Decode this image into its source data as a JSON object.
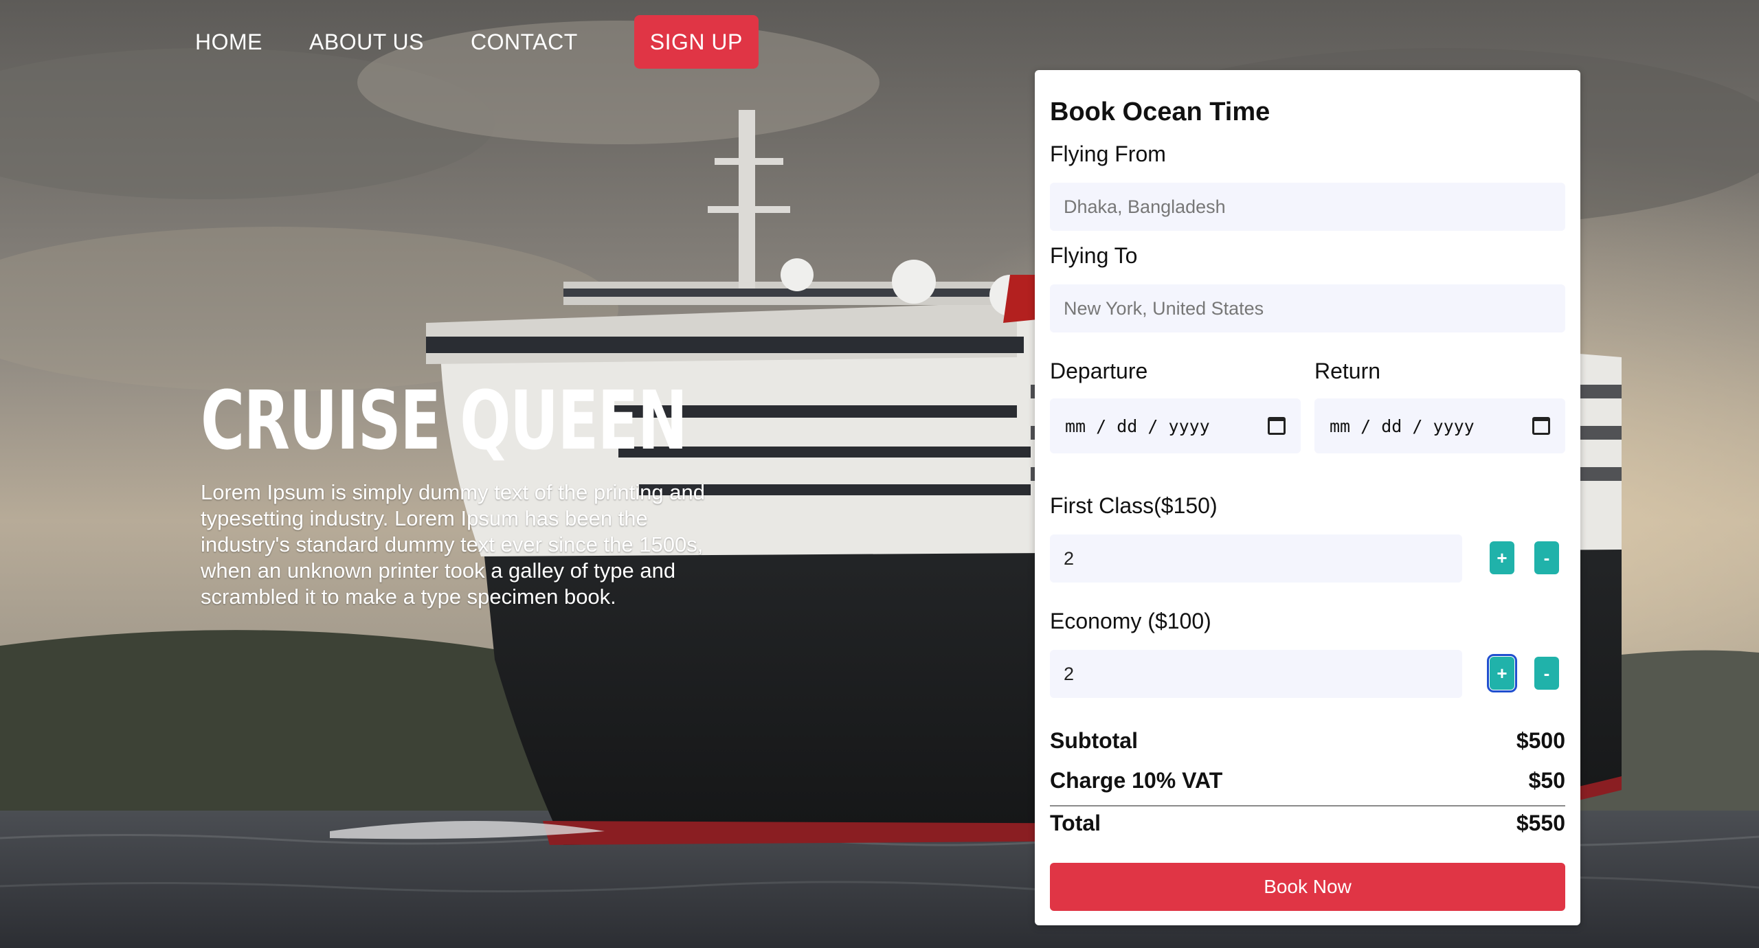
{
  "nav": {
    "items": [
      "HOME",
      "ABOUT US",
      "CONTACT"
    ],
    "signup": "SIGN UP"
  },
  "hero": {
    "title": "CRUISE QUEEN",
    "text": "Lorem Ipsum is simply dummy text of the printing and typesetting industry. Lorem Ipsum has been the industry's standard dummy text ever since the 1500s, when an unknown printer took a galley of type and scrambled it to make a type specimen book."
  },
  "booking": {
    "title": "Book Ocean Time",
    "from_label": "Flying From",
    "from_placeholder": "Dhaka, Bangladesh",
    "to_label": "Flying To",
    "to_placeholder": "New York, United States",
    "departure_label": "Departure",
    "return_label": "Return",
    "date_placeholder": "mm / dd / yyyy",
    "first_label": "First Class($150)",
    "first_value": "2",
    "economy_label": "Economy ($100)",
    "economy_value": "2",
    "plus": "+",
    "minus": "-",
    "subtotal_label": "Subtotal",
    "subtotal_value": "$500",
    "vat_label": "Charge 10% VAT",
    "vat_value": "$50",
    "total_label": "Total",
    "total_value": "$550",
    "book_button": "Book Now"
  },
  "colors": {
    "accent": "#e03545",
    "stepper": "#20b2aa",
    "field_bg": "#f4f5fd"
  }
}
